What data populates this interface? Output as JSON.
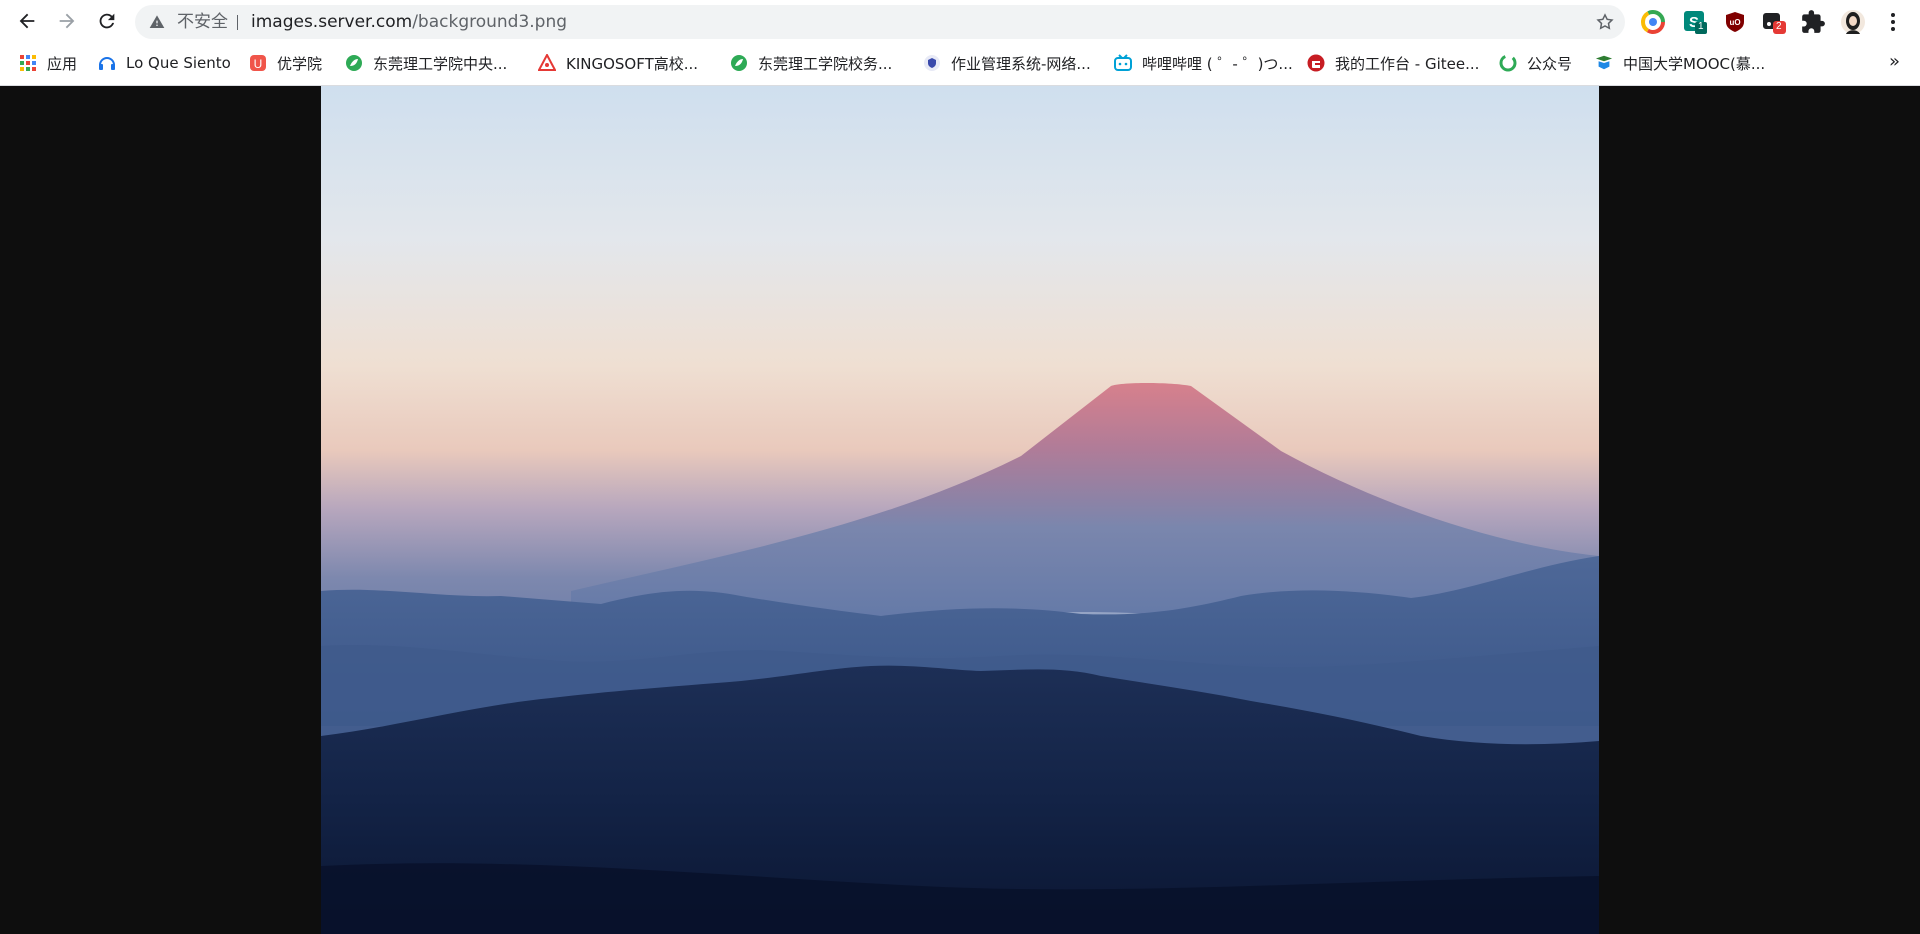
{
  "toolbar": {
    "security_label": "不安全",
    "url_host": "images.server.com",
    "url_path": "/background3.png",
    "extensions": [
      "chrome-colors-icon",
      "s-extension-icon",
      "ublock-icon",
      "extension-badge-icon",
      "puzzle-icon",
      "profile-avatar"
    ],
    "extension_badges": {
      "s_extension": "1",
      "dark_extension": "2"
    }
  },
  "bookmarks": {
    "items": [
      {
        "label": "应用",
        "icon": "apps-grid-icon"
      },
      {
        "label": "Lo Que Siento",
        "icon": "headphones-icon"
      },
      {
        "label": "优学院",
        "icon": "ulearning-icon"
      },
      {
        "label": "东莞理工学院中央...",
        "icon": "leaf-logo-icon"
      },
      {
        "label": "KINGOSOFT高校...",
        "icon": "kingosoft-icon"
      },
      {
        "label": "东莞理工学院校务...",
        "icon": "leaf-logo-icon"
      },
      {
        "label": "作业管理系统-网络...",
        "icon": "shield-logo-icon"
      },
      {
        "label": "哔哩哔哩 ( ゜- ゜)つ...",
        "icon": "bilibili-icon"
      },
      {
        "label": "我的工作台 - Gitee...",
        "icon": "gitee-icon"
      },
      {
        "label": "公众号",
        "icon": "wechat-icon"
      },
      {
        "label": "中国大学MOOC(慕...",
        "icon": "mooc-icon"
      }
    ],
    "more_label": "»"
  },
  "content": {
    "image_description_icon": "mountain-landscape-image"
  }
}
